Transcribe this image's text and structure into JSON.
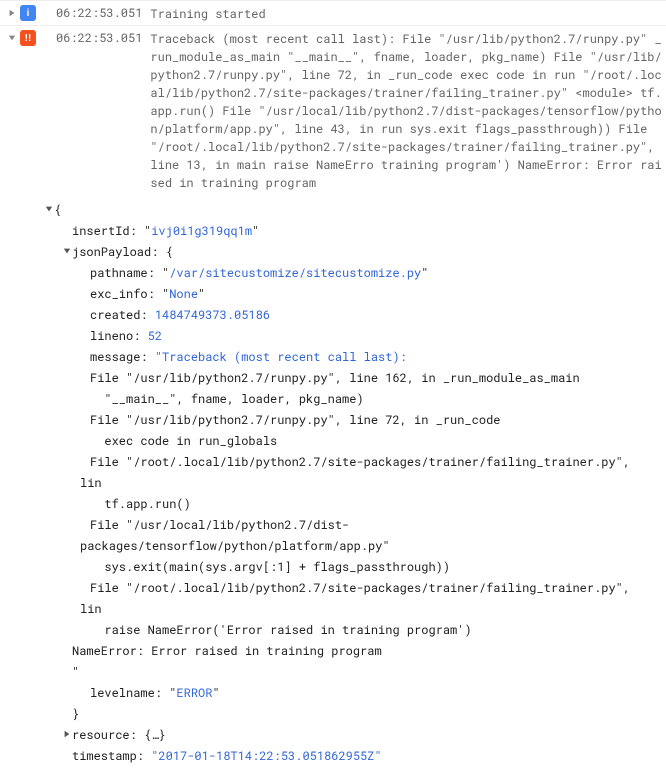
{
  "logs": [
    {
      "severity": "INFO",
      "severity_glyph": "i",
      "timestamp": "06:22:53.051",
      "message": "Training started",
      "expanded": false
    },
    {
      "severity": "ERROR",
      "severity_glyph": "!!",
      "timestamp": "06:22:53.051",
      "message": "Traceback (most recent call last): File \"/usr/lib/python2.7/runpy.py\" _run_module_as_main \"__main__\", fname, loader, pkg_name) File \"/usr/lib/python2.7/runpy.py\", line 72, in _run_code exec code in run \"/root/.local/lib/python2.7/site-packages/trainer/failing_trainer.py\" <module> tf.app.run() File \"/usr/local/lib/python2.7/dist-packages/tensorflow/python/platform/app.py\", line 43, in run sys.exit flags_passthrough)) File \"/root/.local/lib/python2.7/site-packages/trainer/failing_trainer.py\", line 13, in main raise NameErro training program') NameError: Error raised in training program",
      "expanded": true
    }
  ],
  "expanded": {
    "insertId": "ivj0i1g319qq1m",
    "jsonPayload": {
      "pathname": "/var/sitecustomize/sitecustomize.py",
      "exc_info": "None",
      "created": 1484749373.05186,
      "lineno": 52,
      "message_lines": [
        "\"Traceback (most recent call last):",
        "File \"/usr/lib/python2.7/runpy.py\", line 162, in _run_module_as_main",
        "  \"__main__\", fname, loader, pkg_name)",
        "File \"/usr/lib/python2.7/runpy.py\", line 72, in _run_code",
        "  exec code in run_globals",
        "File \"/root/.local/lib/python2.7/site-packages/trainer/failing_trainer.py\", lin",
        "  tf.app.run()",
        "File \"/usr/local/lib/python2.7/dist-packages/tensorflow/python/platform/app.py\"",
        "  sys.exit(main(sys.argv[:1] + flags_passthrough))",
        "File \"/root/.local/lib/python2.7/site-packages/trainer/failing_trainer.py\", lin",
        "  raise NameError('Error raised in training program')",
        "NameError: Error raised in training program",
        "\""
      ],
      "levelname": "ERROR"
    },
    "resource_preview": "{…}",
    "timestamp_partial": "\"2017-01-18T14:22:53.051862955Z\""
  },
  "labels": {
    "insertId": "insertId:",
    "jsonPayload": "jsonPayload:",
    "pathname": "pathname:",
    "exc_info": "exc_info:",
    "created": "created:",
    "lineno": "lineno:",
    "message": "message:",
    "levelname": "levelname:",
    "resource": "resource:",
    "timestamp": "timestamp:"
  }
}
